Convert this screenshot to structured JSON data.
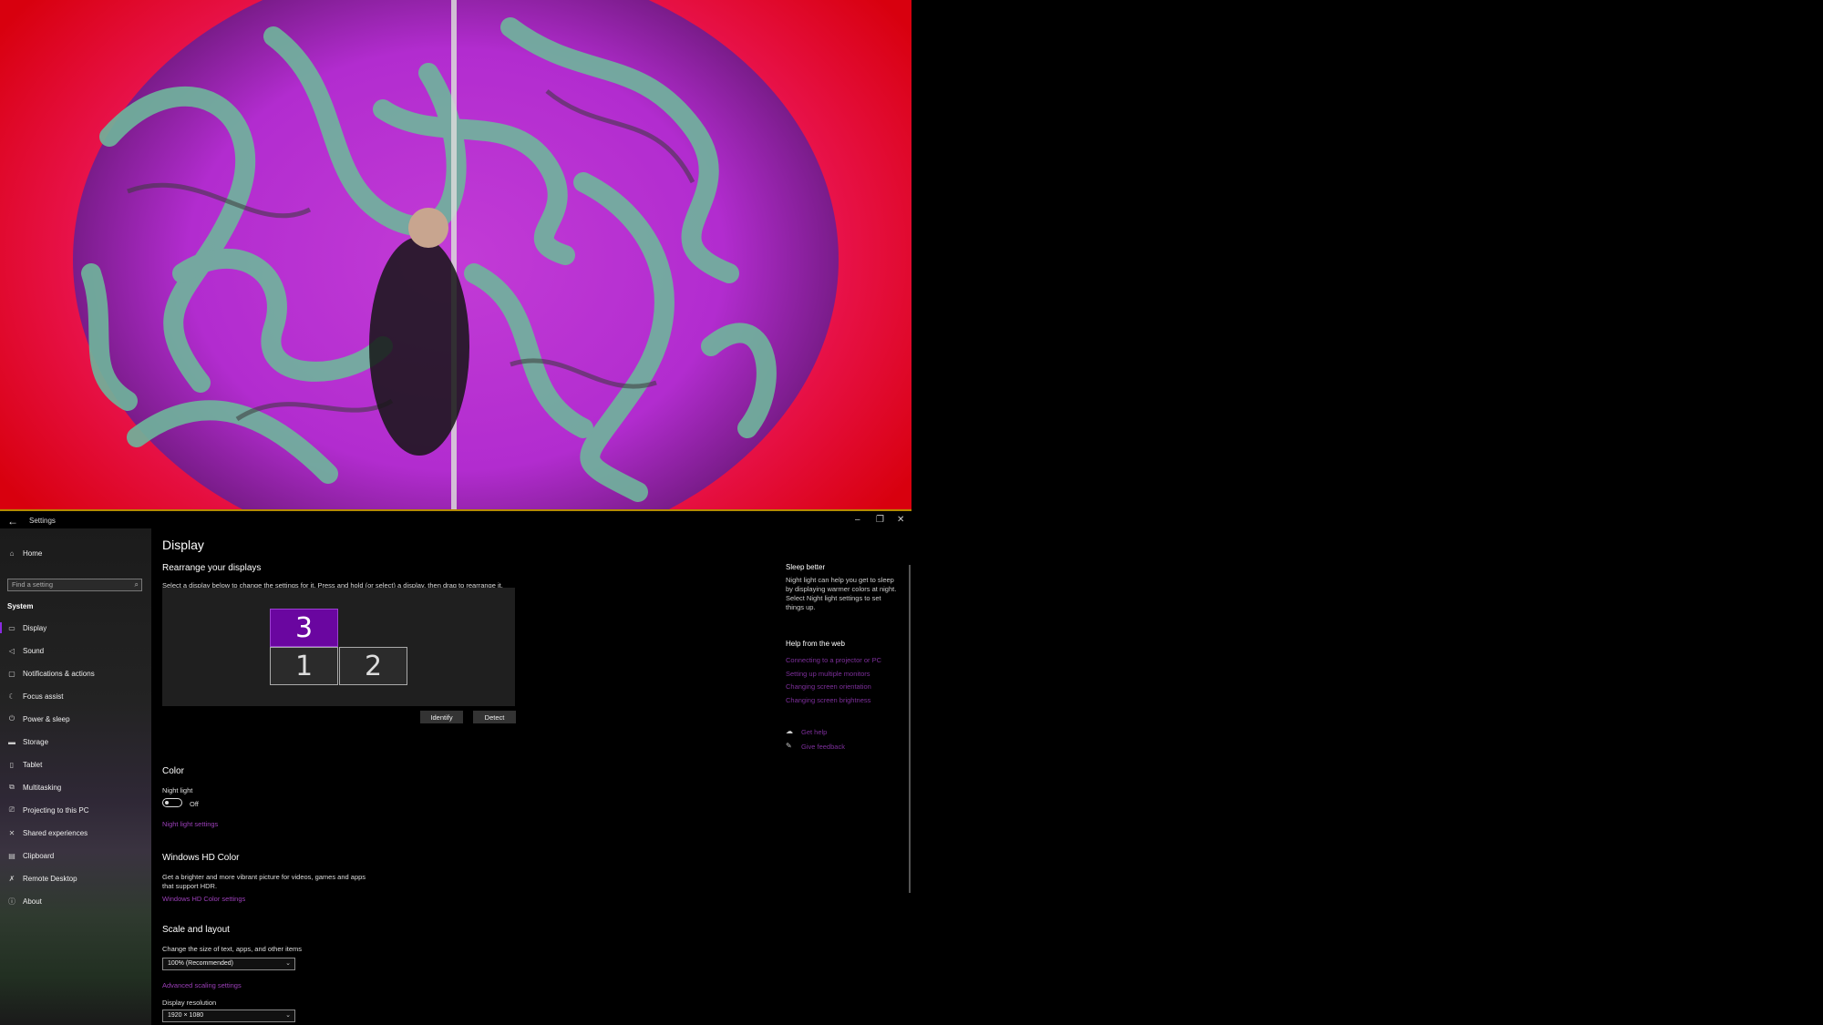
{
  "window": {
    "title": "Settings"
  },
  "sidebar": {
    "home": "Home",
    "search_placeholder": "Find a setting",
    "section": "System",
    "items": [
      {
        "label": "Display",
        "icon": "monitor-icon"
      },
      {
        "label": "Sound",
        "icon": "speaker-icon"
      },
      {
        "label": "Notifications & actions",
        "icon": "notifications-icon"
      },
      {
        "label": "Focus assist",
        "icon": "moon-icon"
      },
      {
        "label": "Power & sleep",
        "icon": "power-icon"
      },
      {
        "label": "Storage",
        "icon": "storage-icon"
      },
      {
        "label": "Tablet",
        "icon": "tablet-icon"
      },
      {
        "label": "Multitasking",
        "icon": "multitasking-icon"
      },
      {
        "label": "Projecting to this PC",
        "icon": "projecting-icon"
      },
      {
        "label": "Shared experiences",
        "icon": "shared-icon"
      },
      {
        "label": "Clipboard",
        "icon": "clipboard-icon"
      },
      {
        "label": "Remote Desktop",
        "icon": "remote-desktop-icon"
      },
      {
        "label": "About",
        "icon": "info-icon"
      }
    ]
  },
  "main": {
    "title": "Display",
    "rearrange": {
      "heading": "Rearrange your displays",
      "description": "Select a display below to change the settings for it. Press and hold (or select) a display, then drag to rearrange it.",
      "monitors": [
        "3",
        "1",
        "2"
      ],
      "identify": "Identify",
      "detect": "Detect"
    },
    "color": {
      "heading": "Color",
      "night_light_label": "Night light",
      "night_light_state": "Off",
      "night_light_link": "Night light settings"
    },
    "hdr": {
      "heading": "Windows HD Color",
      "description_line1": "Get a brighter and more vibrant picture for videos, games and apps",
      "description_line2": "that support HDR.",
      "link": "Windows HD Color settings"
    },
    "scale": {
      "heading": "Scale and layout",
      "size_label": "Change the size of text, apps, and other items",
      "size_value": "100% (Recommended)",
      "advanced_link": "Advanced scaling settings",
      "resolution_label": "Display resolution",
      "resolution_value": "1920 × 1080"
    }
  },
  "right_panel": {
    "sleep_heading": "Sleep better",
    "sleep_text": "Night light can help you get to sleep by displaying warmer colors at night. Select Night light settings to set things up.",
    "help_heading": "Help from the web",
    "help_links": [
      "Connecting to a projector or PC",
      "Setting up multiple monitors",
      "Changing screen orientation",
      "Changing screen brightness"
    ],
    "get_help": "Get help",
    "give_feedback": "Give feedback"
  }
}
